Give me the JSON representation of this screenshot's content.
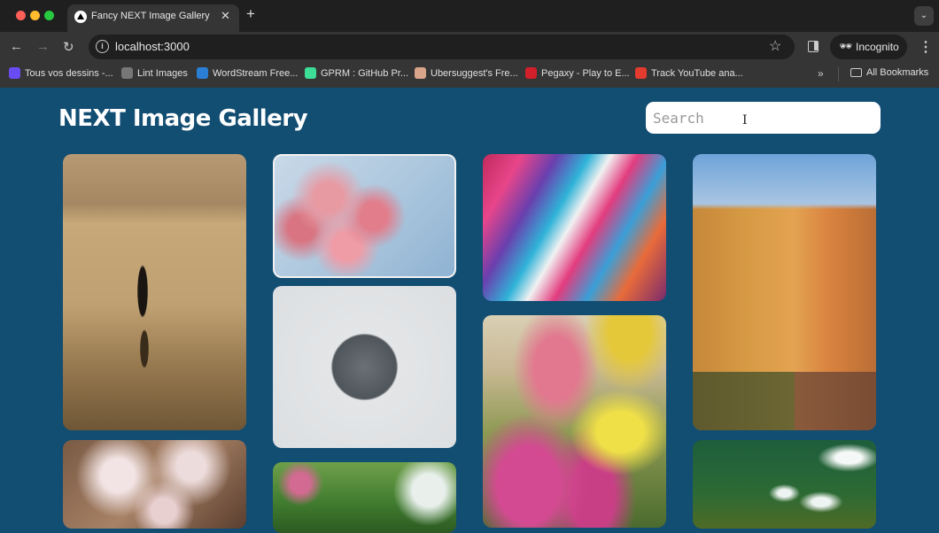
{
  "browser": {
    "tab_title": "Fancy NEXT Image Gallery",
    "url": "localhost:3000",
    "profile_label": "Incognito",
    "bookmarks": [
      {
        "label": "Tous vos dessins -...",
        "icon": "canva-icon",
        "color": "#6a4cf5"
      },
      {
        "label": "Lint Images",
        "icon": "globe-icon",
        "color": "#777777"
      },
      {
        "label": "WordStream Free...",
        "icon": "wordstream-icon",
        "color": "#2a7fd4"
      },
      {
        "label": "GPRM : GitHub Pr...",
        "icon": "gprm-icon",
        "color": "#3ddc97"
      },
      {
        "label": "Ubersuggest's Fre...",
        "icon": "ubersuggest-icon",
        "color": "#d9a58a"
      },
      {
        "label": "Pegaxy - Play to E...",
        "icon": "pegaxy-icon",
        "color": "#d21f2a"
      },
      {
        "label": "Track YouTube ana...",
        "icon": "analytics-icon",
        "color": "#e33b2e"
      }
    ],
    "more_label": "»",
    "all_bookmarks_label": "All Bookmarks"
  },
  "page": {
    "title": "NEXT Image Gallery",
    "search_placeholder": "Search",
    "background": "#124d72"
  },
  "gallery": {
    "images": [
      {
        "name": "gallery-image-man-standing-in-water",
        "subject": "man standing in shallow water"
      },
      {
        "name": "gallery-image-cherry-blossom-branch",
        "subject": "cherry blossom branch"
      },
      {
        "name": "gallery-image-colorful-motion-blur",
        "subject": "colorful abstract motion blur"
      },
      {
        "name": "gallery-image-ponte-vecchio",
        "subject": "Ponte Vecchio buildings over river"
      },
      {
        "name": "gallery-image-feet-in-round-mirror",
        "subject": "legs in round mirror"
      },
      {
        "name": "gallery-image-tulip-market",
        "subject": "tulips in a flower market"
      },
      {
        "name": "gallery-image-white-blossoms",
        "subject": "white blossoms"
      },
      {
        "name": "gallery-image-green-garden",
        "subject": "green garden foliage"
      },
      {
        "name": "gallery-image-ocean-waves",
        "subject": "aerial ocean waves"
      }
    ]
  }
}
